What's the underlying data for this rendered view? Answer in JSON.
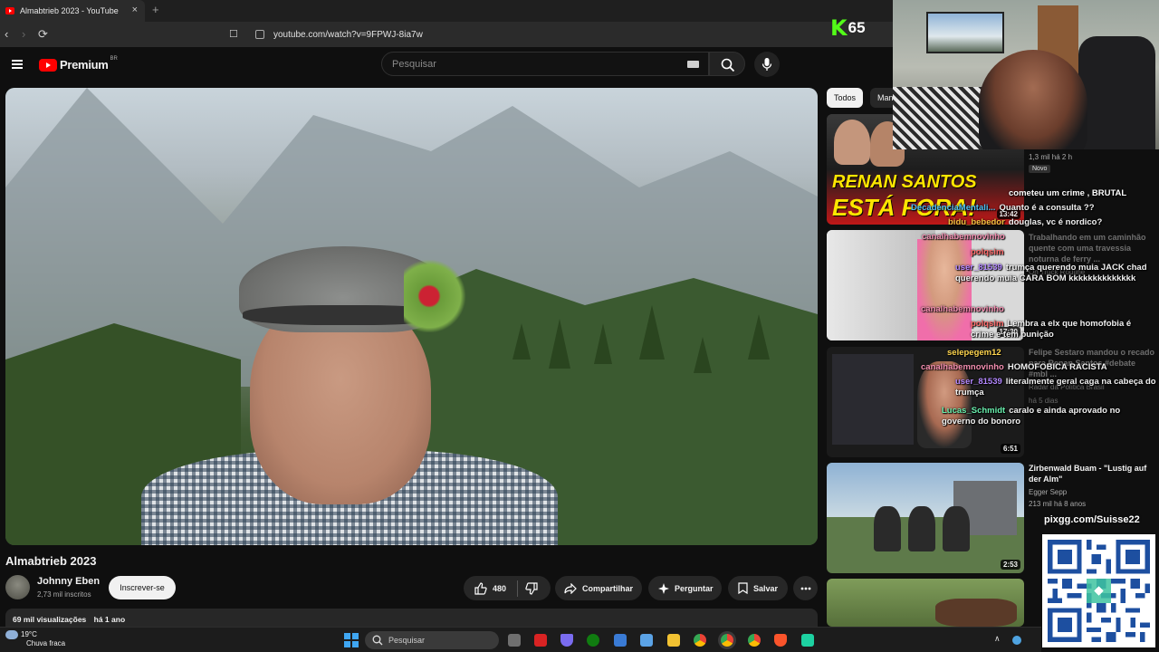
{
  "browser": {
    "tab_title": "Almabtrieb 2023 - YouTube",
    "tab_close": "×",
    "new_tab": "+",
    "url": "youtube.com/watch?v=9FPWJ-8ia7w"
  },
  "youtube_header": {
    "logo_text": "Premium",
    "logo_country": "BR",
    "search_placeholder": "Pesquisar"
  },
  "video": {
    "title": "Almabtrieb 2023",
    "channel_name": "Johnny Eben",
    "subscribers": "2,73 mil inscritos",
    "subscribe_label": "Inscrever-se",
    "likes": "480",
    "share_label": "Compartilhar",
    "ask_label": "Perguntar",
    "save_label": "Salvar",
    "views": "69 mil visualizações",
    "age": "há 1 ano"
  },
  "sidebar": {
    "chips": [
      "Todos",
      "Man"
    ],
    "recommendations": [
      {
        "thumb_text_1": "RENAN SANTOS",
        "thumb_text_2": "ESTÁ FORA!",
        "duration": "13:42",
        "meta": "1,3 mil  há 2 h",
        "badge": "Novo"
      },
      {
        "title": "Trabalhando em um caminhão quente com uma travessia noturna de ferry ...",
        "channel": "On Truck Routine",
        "duration": "17:30"
      },
      {
        "title": "Felipe Sestaro mandou o recado para Renan Santos #debate #mbl ...",
        "channel": "Radar da Política Brasil",
        "meta": "há 5 dias",
        "duration": "6:51"
      },
      {
        "title": "Zirbenwald Buam - \"Lustig auf der Alm\"",
        "channel": "Egger Sepp",
        "meta": "213 mil  há 8 anos",
        "duration": "2:53"
      }
    ]
  },
  "stream": {
    "kick_logo": "K",
    "kick_count": "65",
    "donation_label": "pixgg.com/Suisse22",
    "chat": [
      {
        "user": "",
        "text": "cometeu um crime , BRUTAL",
        "color": "#ffffff"
      },
      {
        "user": "DecadenciaMentali...",
        "text": "Quanto é a consulta ??",
        "color": "#4fc3f7"
      },
      {
        "user": "bidu_bebedor",
        "text": "douglas, vc é nordico?",
        "color": "#f0c040"
      },
      {
        "user": "canalhabemnovinho",
        "text": "",
        "color": "#f48fb1"
      },
      {
        "user": "polqsim",
        "text": "",
        "color": "#ff6b6b"
      },
      {
        "user": "user_81539",
        "text": "trumça querendo muia JACK chad querendo muia CARA BOM kkkkkkkkkkkkkk",
        "color": "#b388ff"
      },
      {
        "user": "canalhabemnovinho",
        "text": "",
        "color": "#f48fb1"
      },
      {
        "user": "polqsim",
        "text": "Lembra a elx que homofobia é crime e tem punição",
        "color": "#ff6b6b"
      },
      {
        "user": "selepegem12",
        "text": "",
        "color": "#ffd54f"
      },
      {
        "user": "canalhabemnovinho",
        "text": "HOMOFOBICA RACISTA",
        "color": "#f48fb1"
      },
      {
        "user": "user_81539",
        "text": "literalmente geral caga na cabeça do trumça",
        "color": "#b388ff"
      },
      {
        "user": "Lucas_Schmidt",
        "text": "caralo e ainda aprovado no governo do bonoro",
        "color": "#69f0ae"
      }
    ]
  },
  "taskbar": {
    "temp": "19°C",
    "weather": "Chuva fraca",
    "search_placeholder": "Pesquisar"
  }
}
